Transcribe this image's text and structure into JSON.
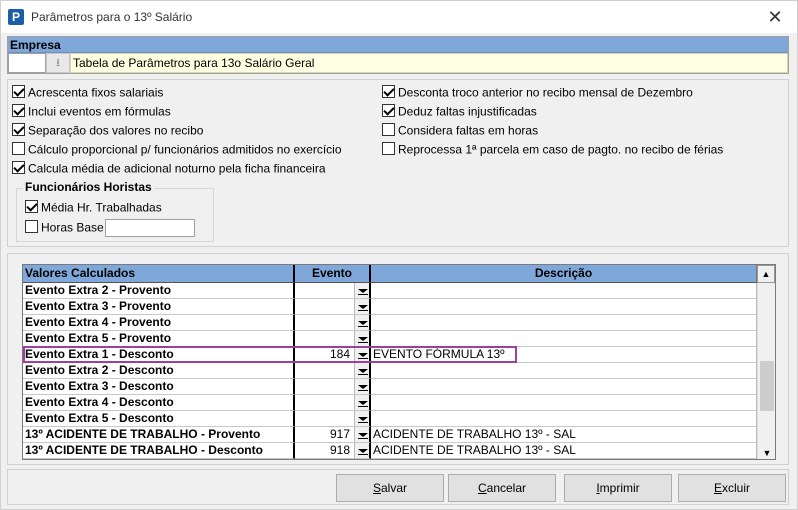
{
  "window": {
    "title": "Parâmetros para o 13º Salário",
    "app_icon_letter": "P"
  },
  "empresa": {
    "label": "Empresa",
    "code_value": "",
    "name_value": "Tabela de Parâmetros para 13o Salário Geral"
  },
  "options_left": [
    {
      "label": "Acrescenta fixos salariais",
      "checked": true
    },
    {
      "label": "Inclui eventos em fórmulas",
      "checked": true
    },
    {
      "label": "Separação dos valores no recibo",
      "checked": true
    },
    {
      "label": "Cálculo proporcional p/ funcionários admitidos no exercício",
      "checked": false
    },
    {
      "label": "Calcula média de adicional noturno pela ficha financeira",
      "checked": true
    }
  ],
  "options_right": [
    {
      "label": "Desconta troco anterior no recibo mensal de Dezembro",
      "checked": true
    },
    {
      "label": "Deduz faltas injustificadas",
      "checked": true
    },
    {
      "label": "Considera faltas em horas",
      "checked": false
    },
    {
      "label": "Reprocessa 1ª parcela em caso de pagto. no recibo de férias",
      "checked": false
    }
  ],
  "horistas": {
    "title": "Funcionários Horistas",
    "media": {
      "label": "Média Hr. Trabalhadas",
      "checked": true
    },
    "horas_base": {
      "label": "Horas Base",
      "checked": false,
      "value": ""
    }
  },
  "grid": {
    "headers": {
      "valores": "Valores Calculados",
      "evento": "Evento",
      "descricao": "Descrição"
    },
    "rows": [
      {
        "valor": "Evento Extra 2 - Provento",
        "evento": "",
        "descricao": ""
      },
      {
        "valor": "Evento Extra 3 - Provento",
        "evento": "",
        "descricao": ""
      },
      {
        "valor": "Evento Extra 4 - Provento",
        "evento": "",
        "descricao": ""
      },
      {
        "valor": "Evento Extra 5 - Provento",
        "evento": "",
        "descricao": ""
      },
      {
        "valor": "Evento Extra 1 - Desconto",
        "evento": "184",
        "descricao": "EVENTO FÓRMULA 13º"
      },
      {
        "valor": "Evento Extra 2 - Desconto",
        "evento": "",
        "descricao": ""
      },
      {
        "valor": "Evento Extra 3 - Desconto",
        "evento": "",
        "descricao": ""
      },
      {
        "valor": "Evento Extra 4 - Desconto",
        "evento": "",
        "descricao": ""
      },
      {
        "valor": "Evento Extra 5 - Desconto",
        "evento": "",
        "descricao": ""
      },
      {
        "valor": "13º ACIDENTE DE TRABALHO - Provento",
        "evento": "917",
        "descricao": "ACIDENTE DE TRABALHO 13º - SAL"
      },
      {
        "valor": "13º ACIDENTE DE TRABALHO - Desconto",
        "evento": "918",
        "descricao": "ACIDENTE DE TRABALHO 13º - SAL"
      }
    ],
    "highlight_color": "#9b3fa0"
  },
  "buttons": {
    "salvar": {
      "first": "S",
      "rest": "alvar"
    },
    "cancelar": {
      "first": "C",
      "rest": "ancelar"
    },
    "imprimir": {
      "first": "I",
      "rest": "mprimir"
    },
    "excluir": {
      "first": "E",
      "rest": "xcluir"
    }
  },
  "colors": {
    "header_blue": "#7fa7d9",
    "empresa_bg": "#ffffe1"
  }
}
